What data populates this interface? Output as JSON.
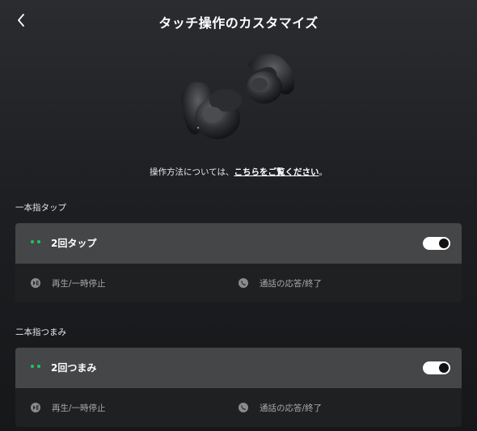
{
  "header": {
    "title": "タッチ操作のカスタマイズ",
    "back_icon": "chevron-left-icon"
  },
  "product_image": "earbuds",
  "help": {
    "text": "操作方法については、",
    "link": "こちらをご覧ください",
    "suffix": "。"
  },
  "sections": [
    {
      "label": "一本指タップ",
      "gesture": "2回タップ",
      "enabled": true,
      "left_action": {
        "icon": "play-pause-icon",
        "label": "再生/一時停止"
      },
      "right_action": {
        "icon": "phone-icon",
        "label": "通話の応答/終了"
      }
    },
    {
      "label": "二本指つまみ",
      "gesture": "2回つまみ",
      "enabled": true,
      "left_action": {
        "icon": "play-pause-icon",
        "label": "再生/一時停止"
      },
      "right_action": {
        "icon": "phone-icon",
        "label": "通話の応答/終了"
      }
    }
  ],
  "colors": {
    "accent": "#22c55e",
    "card_head": "#454648",
    "card_body": "#1f2022"
  }
}
